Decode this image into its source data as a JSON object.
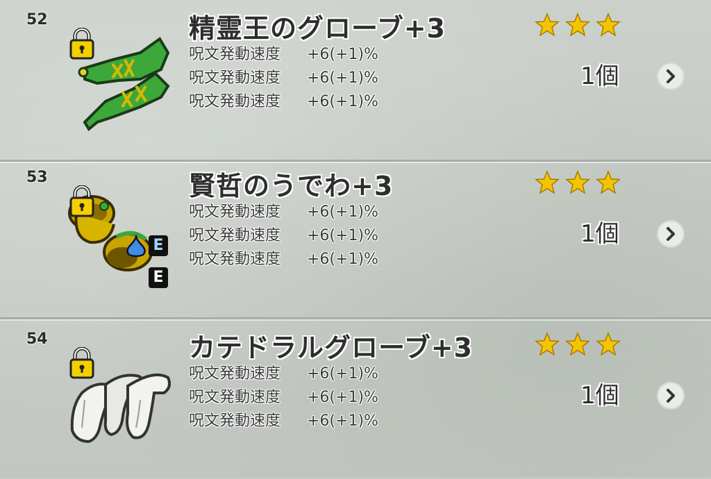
{
  "colors": {
    "background": "#c6ccc5",
    "star": "#f5c400",
    "text": "#2e2e2e",
    "lock": "#f2d000",
    "green_item": "#3ca83a",
    "gold_item": "#c9a400",
    "white_item": "#f2f2ef"
  },
  "items": [
    {
      "number": "52",
      "name": "精霊王のグローブ+3",
      "icon": "green-glove-icon",
      "stats": [
        {
          "label": "呪文発動速度",
          "value": "+6(+1)%"
        },
        {
          "label": "呪文発動速度",
          "value": "+6(+1)%"
        },
        {
          "label": "呪文発動速度",
          "value": "+6(+1)%"
        }
      ],
      "stars": 3,
      "quantity": "1個",
      "locked": true
    },
    {
      "number": "53",
      "name": "賢哲のうでわ+3",
      "icon": "gold-bracelet-icon",
      "stats": [
        {
          "label": "呪文発動速度",
          "value": "+6(+1)%"
        },
        {
          "label": "呪文発動速度",
          "value": "+6(+1)%"
        },
        {
          "label": "呪文発動速度",
          "value": "+6(+1)%"
        }
      ],
      "stars": 3,
      "quantity": "1個",
      "locked": true,
      "equip_badges": [
        "E",
        "E"
      ]
    },
    {
      "number": "54",
      "name": "カテドラルグローブ+3",
      "icon": "white-glove-icon",
      "stats": [
        {
          "label": "呪文発動速度",
          "value": "+6(+1)%"
        },
        {
          "label": "呪文発動速度",
          "value": "+6(+1)%"
        },
        {
          "label": "呪文発動速度",
          "value": "+6(+1)%"
        }
      ],
      "stars": 3,
      "quantity": "1個",
      "locked": true
    }
  ]
}
